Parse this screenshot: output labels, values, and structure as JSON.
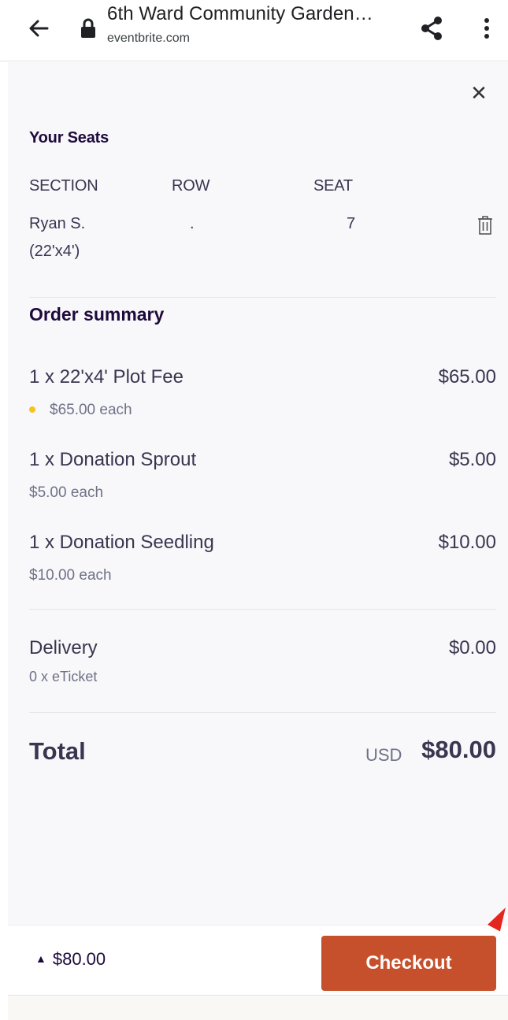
{
  "browser": {
    "title": "6th Ward Community Garden…",
    "domain": "eventbrite.com"
  },
  "seats": {
    "heading": "Your Seats",
    "columns": [
      "SECTION",
      "ROW",
      "SEAT"
    ],
    "row": {
      "section_line1": "Ryan S.",
      "section_line2": "(22'x4')",
      "row": ".",
      "seat": "7"
    }
  },
  "order": {
    "heading": "Order summary",
    "items": [
      {
        "name": "1 x 22'x4' Plot Fee",
        "price": "$65.00",
        "each": "$65.00 each"
      },
      {
        "name": "1 x Donation Sprout",
        "price": "$5.00",
        "each": "$5.00 each"
      },
      {
        "name": "1 x Donation Seedling",
        "price": "$10.00",
        "each": "$10.00 each"
      }
    ],
    "delivery": {
      "name": "Delivery",
      "price": "$0.00",
      "sub": "0 x eTicket"
    },
    "total": {
      "label": "Total",
      "currency": "USD",
      "amount": "$80.00"
    }
  },
  "footer": {
    "total": "$80.00",
    "checkout_label": "Checkout"
  },
  "colors": {
    "accent": "#c6502b",
    "text_dark": "#1e0a3c",
    "highlight_dot": "#f5c518"
  }
}
